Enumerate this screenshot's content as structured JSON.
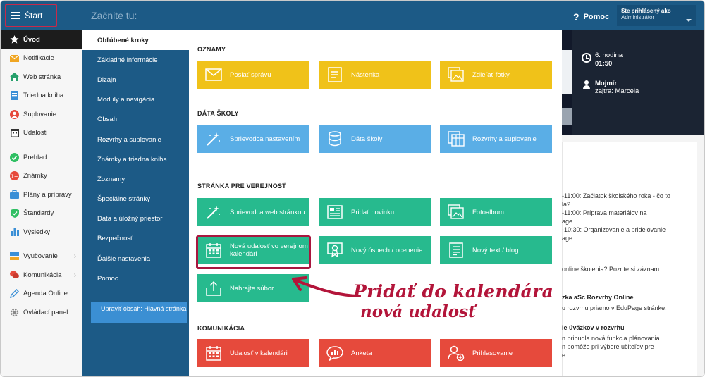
{
  "topbar": {
    "start_label": "Štart",
    "search_placeholder": "Začnite tu:",
    "help_label": "Pomoc",
    "login_status": "Ste prihlásený ako",
    "login_role": "Administrátor"
  },
  "sidebar": {
    "items": [
      {
        "label": "Úvod",
        "icon": "star-icon"
      },
      {
        "label": "Notifikácie",
        "icon": "envelope-icon"
      },
      {
        "label": "Web stránka",
        "icon": "home-icon"
      },
      {
        "label": "Triedna kniha",
        "icon": "book-icon"
      },
      {
        "label": "Suplovanie",
        "icon": "substitute-icon"
      },
      {
        "label": "Udalosti",
        "icon": "calendar-icon"
      },
      {
        "label": "Prehľad",
        "icon": "check-circle-icon"
      },
      {
        "label": "Známky",
        "icon": "grades-icon"
      },
      {
        "label": "Plány a prípravy",
        "icon": "briefcase-icon"
      },
      {
        "label": "Štandardy",
        "icon": "shield-icon"
      },
      {
        "label": "Výsledky",
        "icon": "bar-chart-icon"
      },
      {
        "label": "Vyučovanie",
        "icon": "teaching-icon"
      },
      {
        "label": "Komunikácia",
        "icon": "chat-icon"
      },
      {
        "label": "Agenda Online",
        "icon": "pencil-icon"
      },
      {
        "label": "Ovládací panel",
        "icon": "gear-icon"
      }
    ]
  },
  "menu": {
    "items": [
      "Obľúbené kroky",
      "Základné informácie",
      "Dizajn",
      "Moduly a navigácia",
      "Obsah",
      "Rozvrhy a suplovanie",
      "Známky a triedna kniha",
      "Zoznamy",
      "Špeciálne stránky",
      "Dáta a úložný priestor",
      "Bezpečnosť",
      "Ďalšie nastavenia",
      "Pomoc"
    ],
    "edit_button": "Upraviť obsah: Hlavná stránka"
  },
  "sections": {
    "oznamy": {
      "title": "OZNAMY",
      "tiles": [
        "Poslať správu",
        "Nástenka",
        "Zdieľať fotky"
      ]
    },
    "data_skoly": {
      "title": "DÁTA ŠKOLY",
      "tiles": [
        "Sprievodca nastavením",
        "Dáta školy",
        "Rozvrhy a suplovanie"
      ]
    },
    "verejnost": {
      "title": "STRÁNKA PRE VEREJNOSŤ",
      "tiles": [
        "Sprievodca web stránkou",
        "Pridať novinku",
        "Fotoalbum",
        "Nová udalosť vo verejnom kalendári",
        "Nový úspech / ocenenie",
        "Nový text / blog",
        "Nahrajte súbor"
      ]
    },
    "komunikacia": {
      "title": "KOMUNIKÁCIA",
      "tiles": [
        "Udalosť v kalendári",
        "Anketa",
        "Prihlasovanie"
      ]
    }
  },
  "dashboard": {
    "hour_label": "6. hodina",
    "hour_time": "01:50",
    "person_name": "Mojmír",
    "person_sub": "zajtra: Marcela",
    "news": [
      "-11:00: Začiatok školského roka - čo to",
      "la?",
      "-11:00: Príprava materiálov na",
      "age",
      "-10:30: Organizovanie a pridelovanie",
      "age",
      "online školenia? Pozrite si záznam",
      "zka aSc Rozvrhy Online",
      "u rozvrhu priamo v EduPage stránke.",
      "ie úväzkov v rozvrhu",
      "n pribudla nová funkcia plánovania",
      "n pomôže pri výbere učiteľov pre",
      "e"
    ]
  },
  "annotation": {
    "line1": "Pridať do kalendára",
    "line2": "nová udalosť"
  },
  "colors": {
    "topbar": "#1c5a86",
    "yellow": "#f0c219",
    "blue": "#5aaee6",
    "green": "#27ba8e",
    "red": "#e64a3c",
    "annotation": "#b3153a"
  }
}
